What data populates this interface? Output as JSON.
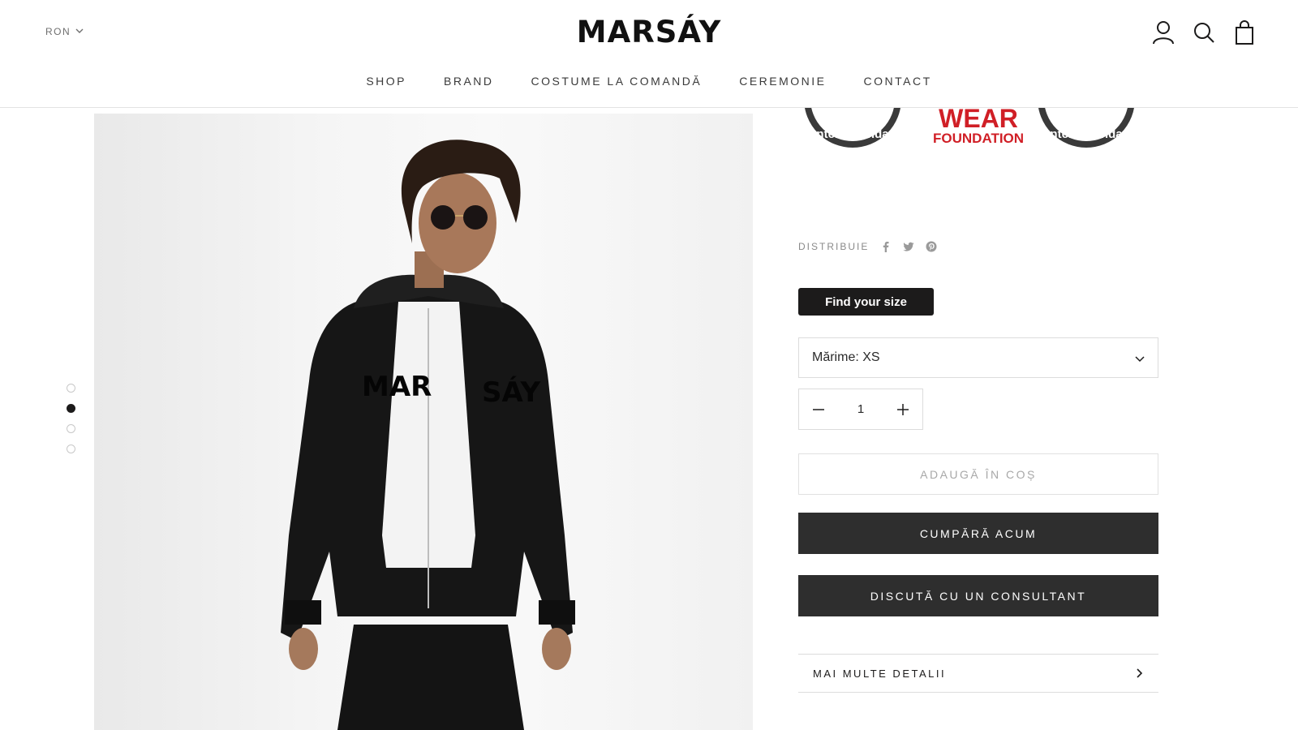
{
  "header": {
    "currency": "RON",
    "logo": "MARSÁY",
    "nav": [
      "SHOP",
      "BRAND",
      "COSTUME LA COMANDĂ",
      "CEREMONIE",
      "CONTACT"
    ]
  },
  "icons": {
    "account": "account-icon",
    "search": "search-icon",
    "cart": "shopping-bag-icon",
    "currency_chevron": "chevron-down-icon"
  },
  "gallery": {
    "slide_count": 4,
    "active_index": 1
  },
  "badges": {
    "left_arc": "ntent standa",
    "center_top": "WEAR",
    "center_bottom": "FOUNDATION",
    "right_arc": "ntent standa"
  },
  "share": {
    "label": "DISTRIBUIE",
    "icons": [
      "facebook-icon",
      "twitter-icon",
      "pinterest-icon"
    ]
  },
  "product": {
    "find_size_label": "Find your size",
    "size_select_value": "Mărime: XS",
    "quantity": "1",
    "add_to_cart_label": "ADAUGĂ ÎN COȘ",
    "buy_now_label": "CUMPĂRĂ ACUM",
    "consultant_label": "DISCUTĂ CU UN CONSULTANT",
    "more_details_label": "MAI MULTE DETALII"
  },
  "colors": {
    "text": "#1c1b1b",
    "dark_button": "#2e2e2e",
    "badge_red": "#d01f26",
    "badge_green": "#2e8b3a"
  }
}
